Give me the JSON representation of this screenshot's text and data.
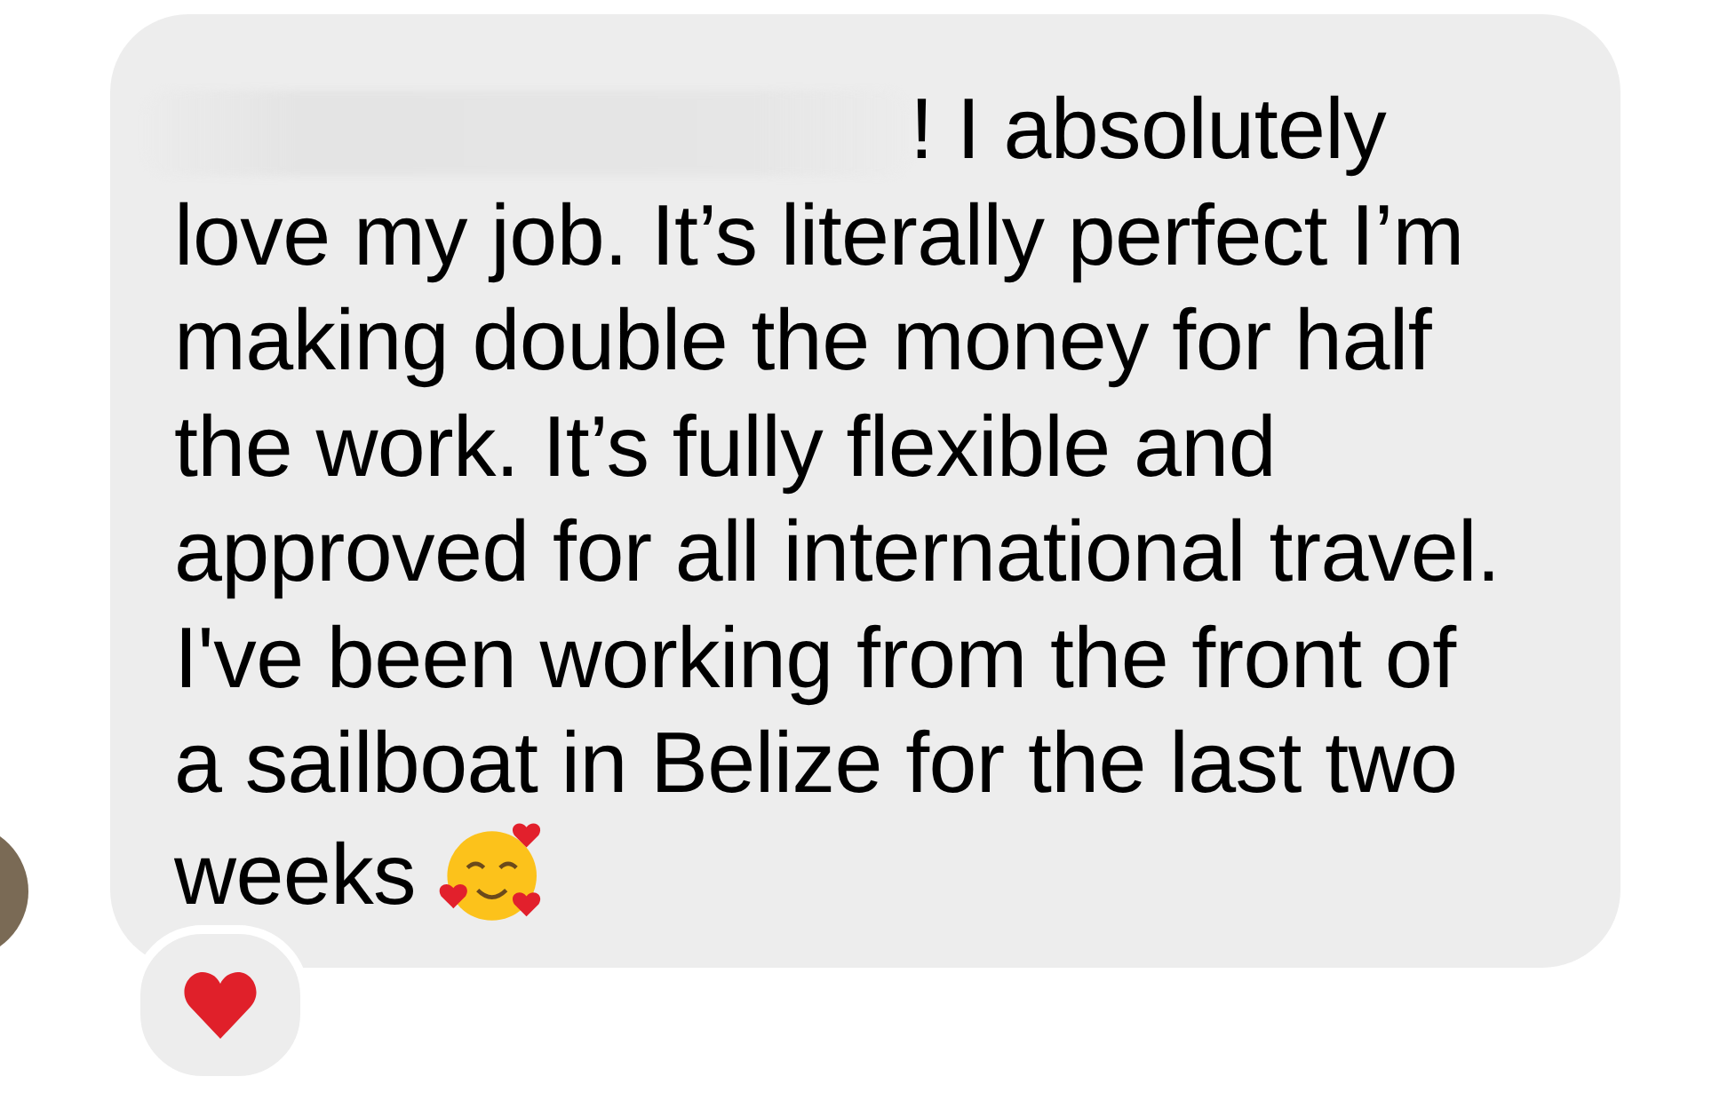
{
  "message": {
    "text": "! I absolutely\nlove my job. It’s literally perfect I’m\nmaking double the money for half\nthe work. It’s fully flexible and\napproved for all international travel.\nI've been working from the front of\na sailboat in Belize for the last two\nweeks",
    "redacted_start": true,
    "reactions": [
      {
        "kind": "heart"
      }
    ]
  }
}
